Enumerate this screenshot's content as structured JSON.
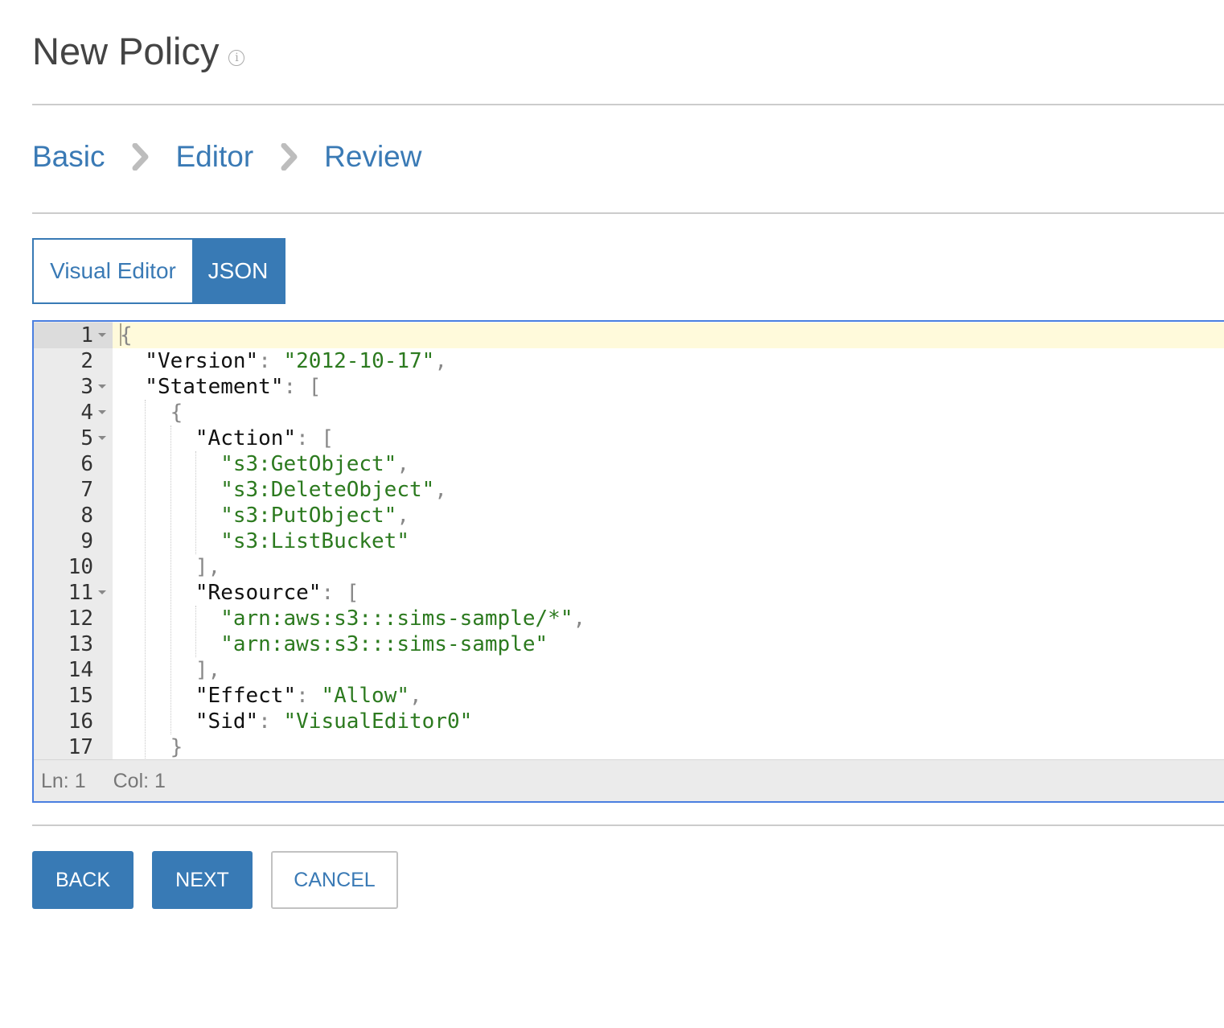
{
  "page": {
    "title": "New Policy",
    "info_icon": "info-circle-icon"
  },
  "steps": [
    {
      "label": "Basic"
    },
    {
      "label": "Editor"
    },
    {
      "label": "Review"
    }
  ],
  "step_separator_icon": "chevron-right-icon",
  "tabs": [
    {
      "label": "Visual Editor",
      "active": false
    },
    {
      "label": "JSON",
      "active": true
    }
  ],
  "editor": {
    "active_line": 1,
    "lines": [
      {
        "n": "1",
        "fold": true,
        "indent": 0,
        "tokens": [
          {
            "t": "p",
            "v": "{"
          }
        ]
      },
      {
        "n": "2",
        "fold": false,
        "indent": 1,
        "tokens": [
          {
            "t": "k",
            "v": "\"Version\""
          },
          {
            "t": "p",
            "v": ": "
          },
          {
            "t": "s",
            "v": "\"2012-10-17\""
          },
          {
            "t": "p",
            "v": ","
          }
        ]
      },
      {
        "n": "3",
        "fold": true,
        "indent": 1,
        "tokens": [
          {
            "t": "k",
            "v": "\"Statement\""
          },
          {
            "t": "p",
            "v": ": ["
          }
        ]
      },
      {
        "n": "4",
        "fold": true,
        "indent": 2,
        "tokens": [
          {
            "t": "p",
            "v": "{"
          }
        ]
      },
      {
        "n": "5",
        "fold": true,
        "indent": 3,
        "tokens": [
          {
            "t": "k",
            "v": "\"Action\""
          },
          {
            "t": "p",
            "v": ": ["
          }
        ]
      },
      {
        "n": "6",
        "fold": false,
        "indent": 4,
        "tokens": [
          {
            "t": "s",
            "v": "\"s3:GetObject\""
          },
          {
            "t": "p",
            "v": ","
          }
        ]
      },
      {
        "n": "7",
        "fold": false,
        "indent": 4,
        "tokens": [
          {
            "t": "s",
            "v": "\"s3:DeleteObject\""
          },
          {
            "t": "p",
            "v": ","
          }
        ]
      },
      {
        "n": "8",
        "fold": false,
        "indent": 4,
        "tokens": [
          {
            "t": "s",
            "v": "\"s3:PutObject\""
          },
          {
            "t": "p",
            "v": ","
          }
        ]
      },
      {
        "n": "9",
        "fold": false,
        "indent": 4,
        "tokens": [
          {
            "t": "s",
            "v": "\"s3:ListBucket\""
          }
        ]
      },
      {
        "n": "10",
        "fold": false,
        "indent": 3,
        "tokens": [
          {
            "t": "p",
            "v": "],"
          }
        ]
      },
      {
        "n": "11",
        "fold": true,
        "indent": 3,
        "tokens": [
          {
            "t": "k",
            "v": "\"Resource\""
          },
          {
            "t": "p",
            "v": ": ["
          }
        ]
      },
      {
        "n": "12",
        "fold": false,
        "indent": 4,
        "tokens": [
          {
            "t": "s",
            "v": "\"arn:aws:s3:::sims-sample/*\""
          },
          {
            "t": "p",
            "v": ","
          }
        ]
      },
      {
        "n": "13",
        "fold": false,
        "indent": 4,
        "tokens": [
          {
            "t": "s",
            "v": "\"arn:aws:s3:::sims-sample\""
          }
        ]
      },
      {
        "n": "14",
        "fold": false,
        "indent": 3,
        "tokens": [
          {
            "t": "p",
            "v": "],"
          }
        ]
      },
      {
        "n": "15",
        "fold": false,
        "indent": 3,
        "tokens": [
          {
            "t": "k",
            "v": "\"Effect\""
          },
          {
            "t": "p",
            "v": ": "
          },
          {
            "t": "s",
            "v": "\"Allow\""
          },
          {
            "t": "p",
            "v": ","
          }
        ]
      },
      {
        "n": "16",
        "fold": false,
        "indent": 3,
        "tokens": [
          {
            "t": "k",
            "v": "\"Sid\""
          },
          {
            "t": "p",
            "v": ": "
          },
          {
            "t": "s",
            "v": "\"VisualEditor0\""
          }
        ]
      },
      {
        "n": "17",
        "fold": false,
        "indent": 2,
        "tokens": [
          {
            "t": "p",
            "v": "}"
          }
        ]
      }
    ],
    "status": {
      "line_label": "Ln: 1",
      "col_label": "Col: 1"
    }
  },
  "buttons": {
    "back": "BACK",
    "next": "NEXT",
    "cancel": "CANCEL"
  },
  "colors": {
    "accent": "#387ab5",
    "link": "#3a7ab5",
    "editor_border": "#4a7fe0",
    "active_line": "#fffadb",
    "string": "#2c7a1f"
  }
}
